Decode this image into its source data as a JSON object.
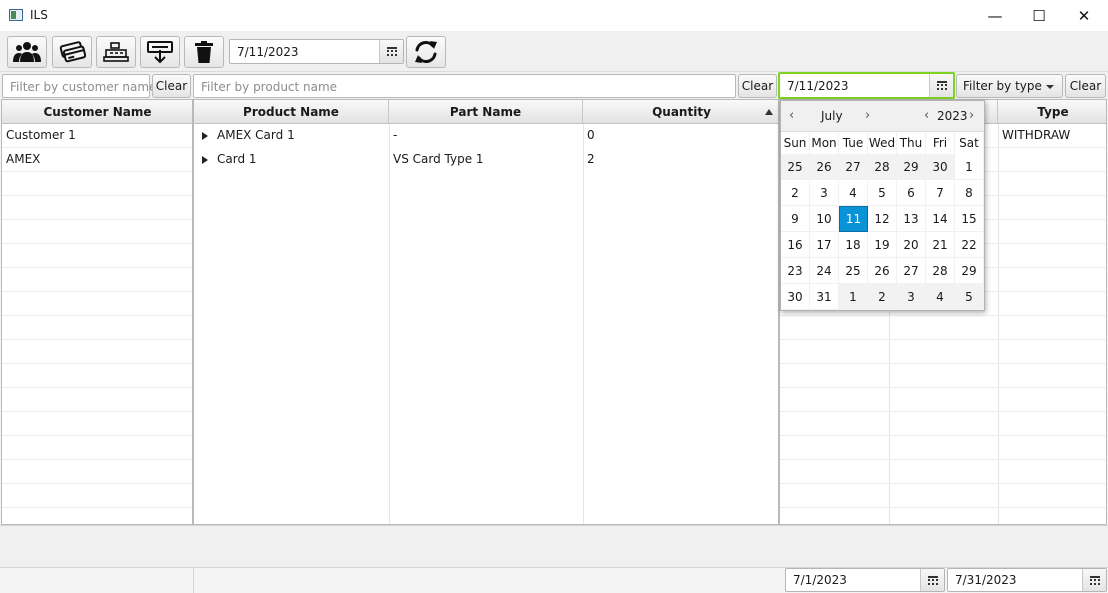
{
  "window": {
    "title": "ILS",
    "minimize": "—",
    "maximize": "☐",
    "close": "✕"
  },
  "toolbar": {
    "buttons": [
      {
        "icon": "customers-icon"
      },
      {
        "icon": "cards-icon"
      },
      {
        "icon": "cash-register-icon"
      },
      {
        "icon": "download-icon"
      },
      {
        "icon": "trash-icon"
      }
    ],
    "date_value": "7/11/2023",
    "refresh_icon": "refresh-icon"
  },
  "filters": {
    "customer_placeholder": "Filter by customer name",
    "customer_clear": "Clear",
    "product_placeholder": "Filter by product name",
    "product_clear": "Clear",
    "date_value": "7/11/2023",
    "type_placeholder": "Filter by type",
    "type_clear": "Clear"
  },
  "customers": {
    "header": "Customer Name",
    "rows": [
      "Customer 1",
      "AMEX"
    ]
  },
  "products": {
    "headers": {
      "product": "Product Name",
      "part": "Part Name",
      "quantity": "Quantity"
    },
    "rows": [
      {
        "product": "AMEX Card 1",
        "part": "-",
        "quantity": "0"
      },
      {
        "product": "Card 1",
        "part": "VS Card Type 1",
        "quantity": "2"
      }
    ]
  },
  "transactions": {
    "header_type": "Type",
    "rows": [
      {
        "type": "WITHDRAW"
      }
    ]
  },
  "datepicker": {
    "month": "July",
    "year": "2023",
    "weekdays": [
      "Sun",
      "Mon",
      "Tue",
      "Wed",
      "Thu",
      "Fri",
      "Sat"
    ],
    "weeks": [
      [
        "25",
        "26",
        "27",
        "28",
        "29",
        "30",
        "1"
      ],
      [
        "2",
        "3",
        "4",
        "5",
        "6",
        "7",
        "8"
      ],
      [
        "9",
        "10",
        "11",
        "12",
        "13",
        "14",
        "15"
      ],
      [
        "16",
        "17",
        "18",
        "19",
        "20",
        "21",
        "22"
      ],
      [
        "23",
        "24",
        "25",
        "26",
        "27",
        "28",
        "29"
      ],
      [
        "30",
        "31",
        "1",
        "2",
        "3",
        "4",
        "5"
      ]
    ],
    "selected": "11",
    "accent": "#0a93d6"
  },
  "status": {
    "from_date": "7/1/2023",
    "to_date": "7/31/2023"
  },
  "colors": {
    "focus_border": "#7ed321"
  }
}
